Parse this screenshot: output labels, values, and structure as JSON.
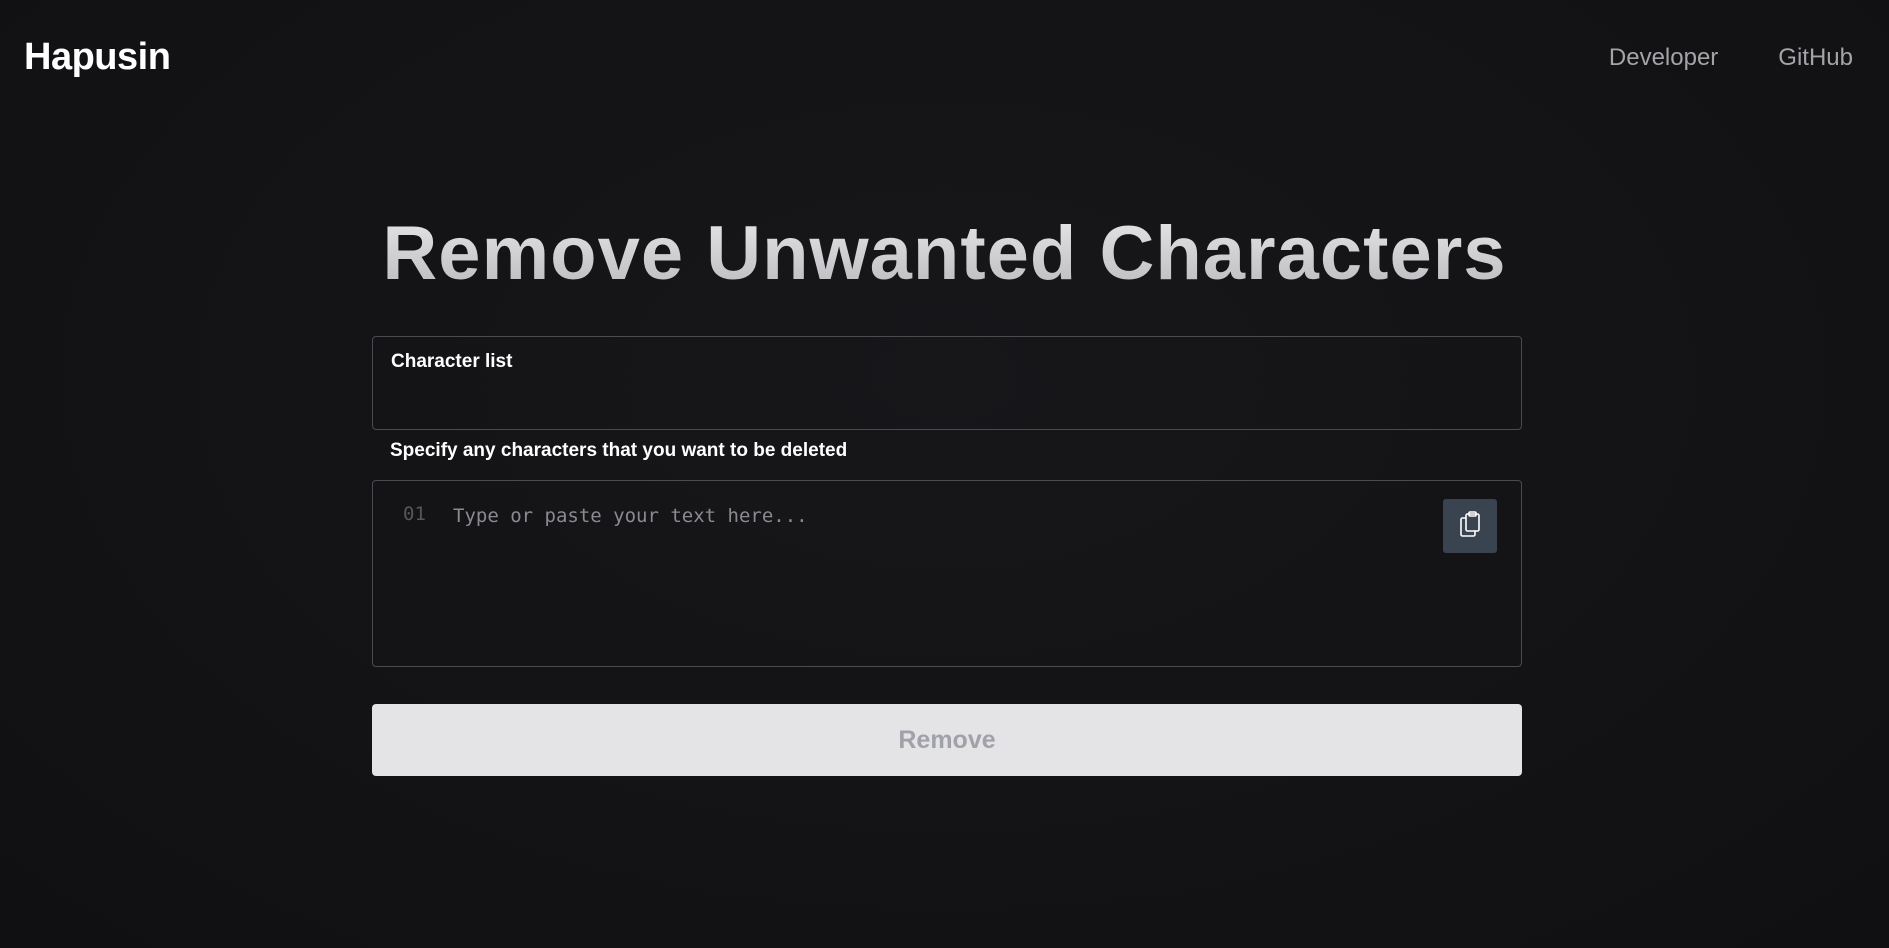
{
  "header": {
    "brand": "Hapusin",
    "nav": [
      {
        "label": "Developer"
      },
      {
        "label": "GitHub"
      }
    ]
  },
  "main": {
    "title": "Remove Unwanted Characters",
    "character_field": {
      "label": "Character list",
      "value": "",
      "helper": "Specify any characters that you want to be deleted"
    },
    "editor": {
      "line_number": "01",
      "placeholder": "Type or paste your text here...",
      "paste_icon": "clipboard-icon"
    },
    "remove_button": {
      "label": "Remove",
      "disabled": true
    }
  },
  "colors": {
    "background": "#141416",
    "border": "#4a4a50",
    "icon_button": "#3a4350",
    "button_bg": "#e4e4e7",
    "button_text": "#a1a1aa",
    "nav_text": "#a3a3a8"
  }
}
